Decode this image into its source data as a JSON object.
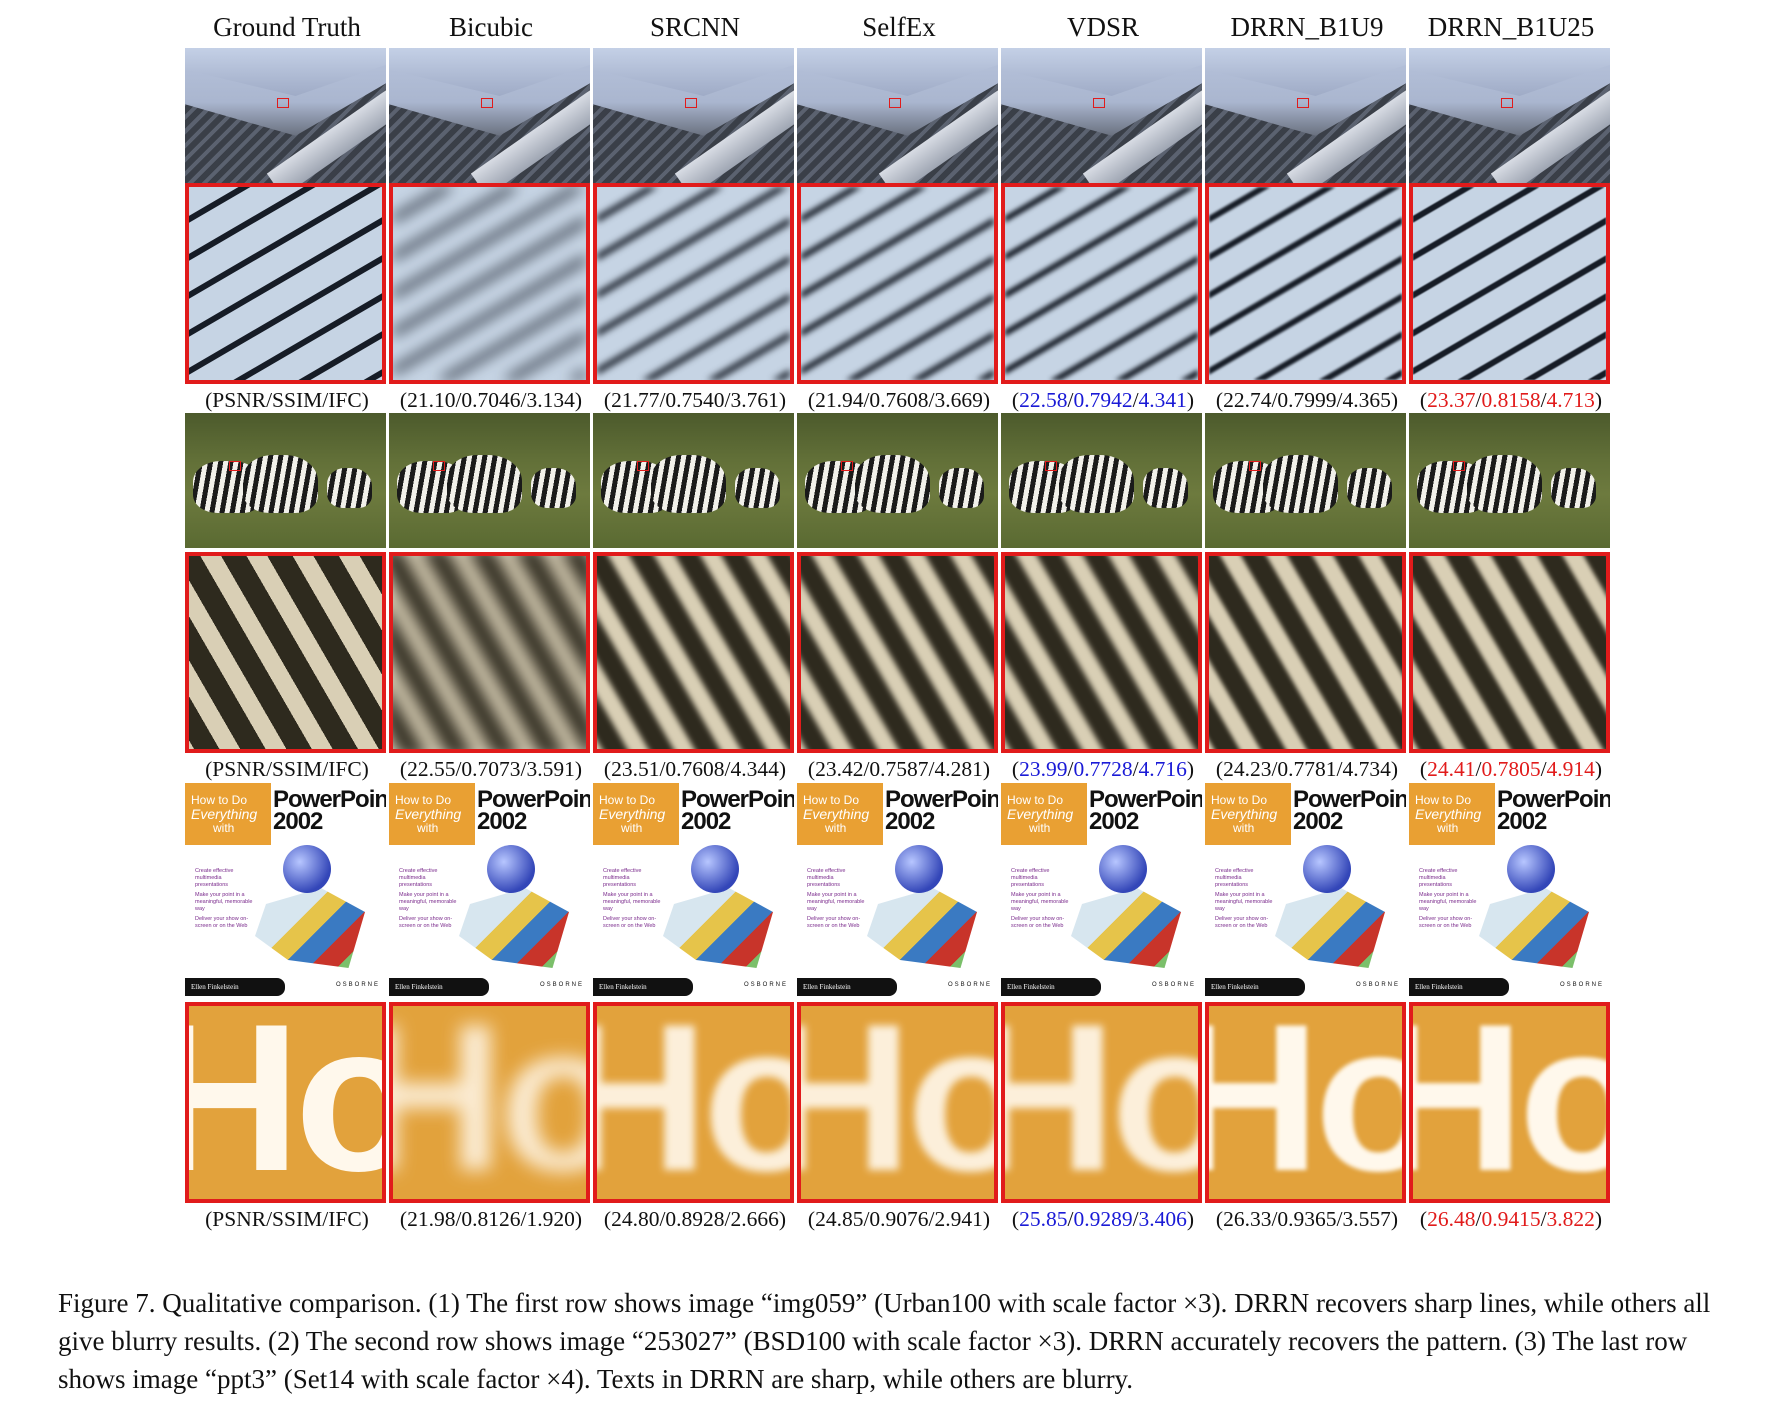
{
  "columns": [
    "Ground Truth",
    "Bicubic",
    "SRCNN",
    "SelfEx",
    "VDSR",
    "DRRN_B1U9",
    "DRRN_B1U25"
  ],
  "metrics_rows": [
    [
      "(PSNR/SSIM/IFC)",
      "(21.10/0.7046/3.134)",
      "(21.77/0.7540/3.761)",
      "(21.94/0.7608/3.669)",
      "(22.58/0.7942/4.341)",
      "(22.74/0.7999/4.365)",
      "(23.37/0.8158/4.713)"
    ],
    [
      "(PSNR/SSIM/IFC)",
      "(22.55/0.7073/3.591)",
      "(23.51/0.7608/4.344)",
      "(23.42/0.7587/4.281)",
      "(23.99/0.7728/4.716)",
      "(24.23/0.7781/4.734)",
      "(24.41/0.7805/4.914)"
    ],
    [
      "(PSNR/SSIM/IFC)",
      "(21.98/0.8126/1.920)",
      "(24.80/0.8928/2.666)",
      "(24.85/0.9076/2.941)",
      "(25.85/0.9289/3.406)",
      "(26.33/0.9365/3.557)",
      "(26.48/0.9415/3.822)"
    ]
  ],
  "metric_highlight": {
    "blue_column": 4,
    "red_column": 6,
    "blue": "#1a1ad6",
    "red": "#e11b1b"
  },
  "book": {
    "how_to": "How to Do",
    "everything": "Everything",
    "with": "with",
    "title": "PowerPoint",
    "year": "2002",
    "bullets": [
      "Create effective multimedia presentations",
      "Make your point in a meaningful, memorable way",
      "Deliver your show on-screen or on the Web"
    ],
    "author": "Ellen Finkelstein",
    "publisher": "OSBORNE",
    "crop_text": "Ho"
  },
  "caption": "Figure 7. Qualitative comparison. (1) The first row shows image “img059” (Urban100 with scale factor ×3). DRRN recovers sharp lines, while others all give blurry results. (2) The second row shows image “253027” (BSD100 with scale factor ×3). DRRN accurately recovers the pattern. (3) The last row shows image “ppt3” (Set14 with scale factor ×4). Texts in DRRN are sharp, while others are blurry."
}
